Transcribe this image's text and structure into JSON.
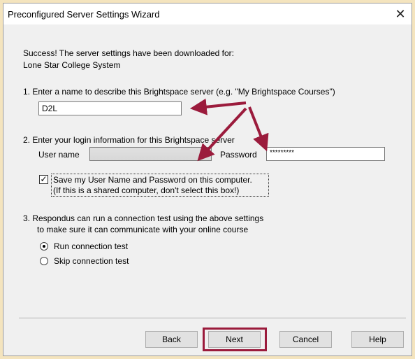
{
  "dialog": {
    "title": "Preconfigured Server Settings Wizard",
    "close_glyph": "✕"
  },
  "intro": {
    "line1": "Success! The server settings have been downloaded for:",
    "line2": "Lone Star College System"
  },
  "step1": {
    "label": "1.  Enter a name to describe this Brightspace server (e.g. \"My Brightspace Courses\")",
    "name_value": "D2L"
  },
  "step2": {
    "label": "2.  Enter your login information for this Brightspace server",
    "username_label": "User name",
    "password_label": "Password",
    "password_value": "*********",
    "save_checked": true,
    "save_line1": "Save my User Name and Password on this computer.",
    "save_line2": "(If this is a shared computer, don't select this box!)"
  },
  "step3": {
    "label_line1": "3.  Respondus can run a connection test using the above settings",
    "label_line2": "to make sure it can communicate with your online course",
    "options": [
      {
        "label": "Run connection test",
        "selected": true
      },
      {
        "label": "Skip connection test",
        "selected": false
      }
    ]
  },
  "buttons": {
    "back": "Back",
    "next": "Next",
    "cancel": "Cancel",
    "help": "Help"
  },
  "annotation_color": "#9b1b3c"
}
